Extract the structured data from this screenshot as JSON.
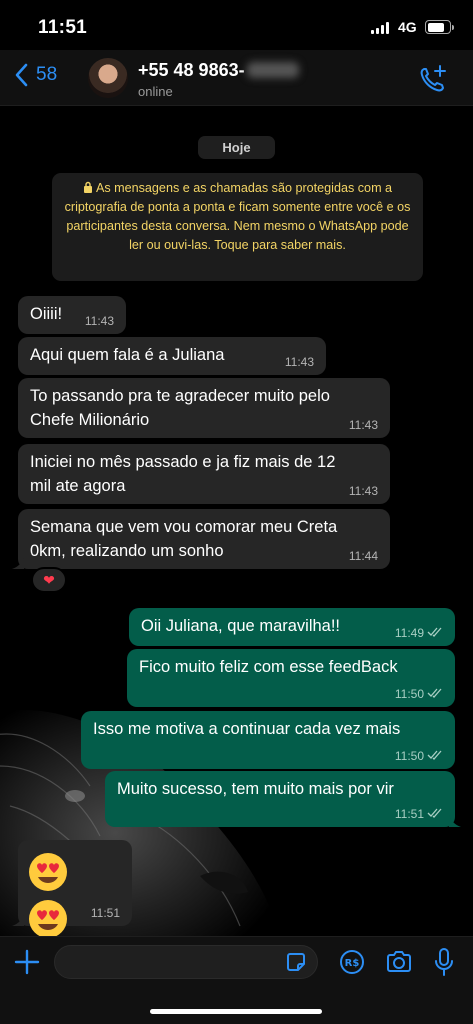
{
  "status_bar": {
    "time": "11:51",
    "network": "4G"
  },
  "header": {
    "back_count": "58",
    "contact_name": "+55 48 9863-",
    "contact_status": "online"
  },
  "chat": {
    "date_label": "Hoje",
    "encryption_notice": "As mensagens e as chamadas são protegidas com a criptografia de ponta a ponta e ficam somente entre você e os participantes desta conversa. Nem mesmo o WhatsApp pode ler ou ouvi-las. Toque para saber mais.",
    "incoming": [
      {
        "text": "Oiiii!",
        "time": "11:43"
      },
      {
        "text": "Aqui quem fala é a Juliana",
        "time": "11:43"
      },
      {
        "text": "To passando pra te agradecer muito pelo Chefe Milionário",
        "time": "11:43"
      },
      {
        "text": "Iniciei no mês passado e ja fiz mais de 12 mil ate agora",
        "time": "11:43"
      },
      {
        "text": "Semana que vem vou comorar meu Creta 0km, realizando um sonho",
        "time": "11:44"
      }
    ],
    "reaction": "❤",
    "outgoing": [
      {
        "text": "Oii Juliana, que maravilha!!",
        "time": "11:49"
      },
      {
        "text": "Fico muito feliz com esse feedBack",
        "time": "11:50"
      },
      {
        "text": "Isso me motiva a continuar cada vez mais",
        "time": "11:50"
      },
      {
        "text": "Muito sucesso, tem muito mais por vir",
        "time": "11:51"
      }
    ],
    "emoji_message": {
      "emoji_names": [
        "heart-eyes-emoji",
        "heart-eyes-emoji"
      ],
      "time": "11:51"
    }
  },
  "colors": {
    "accent": "#2c8ef4",
    "incoming_bubble": "#262626",
    "outgoing_bubble": "#035d4a",
    "notice_text": "#f3d465"
  },
  "icons": [
    "chevron-left-icon",
    "call-add-icon",
    "lock-icon",
    "plus-icon",
    "sticker-icon",
    "payment-icon",
    "camera-icon",
    "microphone-icon",
    "double-check-icon"
  ]
}
